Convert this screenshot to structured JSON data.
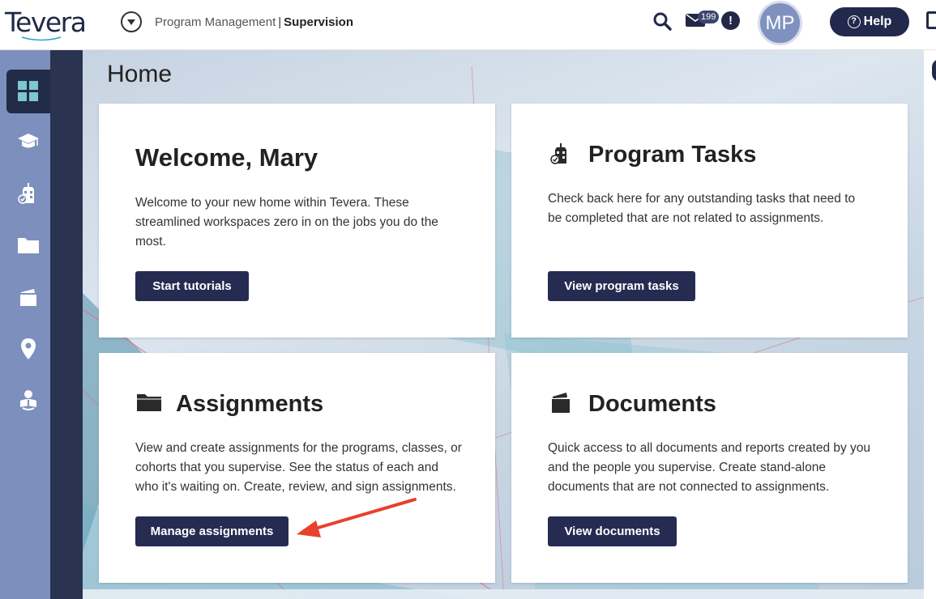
{
  "header": {
    "logo": "Tevera",
    "breadcrumb_parent": "Program Management",
    "breadcrumb_separator": "|",
    "breadcrumb_current": "Supervision",
    "mail_count": "199",
    "alert_symbol": "!",
    "avatar_initials": "MP",
    "help_label": "Help"
  },
  "sidebar": {
    "items": [
      {
        "icon": "dashboard-grid-icon",
        "active": true
      },
      {
        "icon": "graduation-cap-icon",
        "active": false
      },
      {
        "icon": "building-check-icon",
        "active": false
      },
      {
        "icon": "folder-icon",
        "active": false
      },
      {
        "icon": "documents-icon",
        "active": false
      },
      {
        "icon": "map-pin-icon",
        "active": false
      },
      {
        "icon": "person-reading-icon",
        "active": false
      }
    ]
  },
  "page": {
    "title": "Home"
  },
  "cards": {
    "welcome": {
      "title": "Welcome, Mary",
      "description": "Welcome to your new home within Tevera. These streamlined workspaces zero in on the jobs you do the most.",
      "button": "Start tutorials"
    },
    "program_tasks": {
      "icon": "building-check-icon",
      "title": "Program Tasks",
      "description": "Check back here for any outstanding tasks that need to be completed that are not related to assignments.",
      "button": "View program tasks"
    },
    "assignments": {
      "icon": "folder-icon",
      "title": "Assignments",
      "description": "View and create assignments for the programs, classes, or cohorts that you supervise. See the status of each and who it's waiting on. Create, review, and sign assignments.",
      "button": "Manage assignments"
    },
    "documents": {
      "icon": "documents-icon",
      "title": "Documents",
      "description": "Quick access to all documents and reports created by you and the people you supervise. Create stand-alone documents that are not connected to assignments.",
      "button": "View documents"
    }
  },
  "colors": {
    "brand_navy": "#262b52",
    "sidebar": "#7d8fbd",
    "annotation_arrow": "#e8412c"
  }
}
